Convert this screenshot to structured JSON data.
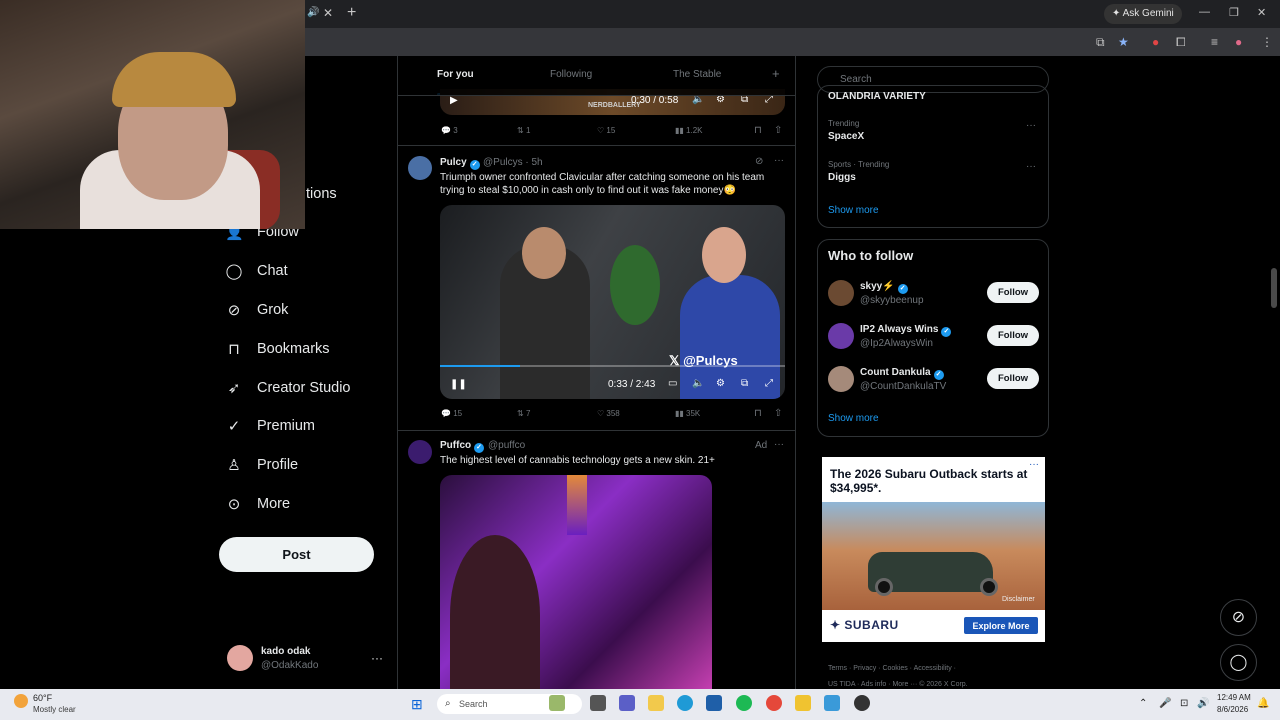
{
  "browser": {
    "ask_gemini": "Ask Gemini",
    "new_tab": "+",
    "tab_close": "✕",
    "minimize": "—",
    "restore": "❐",
    "close": "✕"
  },
  "webcam": {
    "partial_text": "tions"
  },
  "nav": {
    "items": [
      {
        "label": "Follow",
        "icon": "follow-icon"
      },
      {
        "label": "Chat",
        "icon": "chat-icon"
      },
      {
        "label": "Grok",
        "icon": "grok-icon"
      },
      {
        "label": "Bookmarks",
        "icon": "bookmark-icon"
      },
      {
        "label": "Creator Studio",
        "icon": "rocket-icon"
      },
      {
        "label": "Premium",
        "icon": "premium-icon"
      },
      {
        "label": "Profile",
        "icon": "profile-icon"
      },
      {
        "label": "More",
        "icon": "more-icon"
      }
    ],
    "post_label": "Post",
    "account": {
      "name": "kado odak",
      "handle": "@OdakKado",
      "more": "···"
    }
  },
  "feed": {
    "tabs": [
      "For you",
      "Following",
      "The Stable"
    ],
    "add_tab": "+",
    "tweet1": {
      "video_time": "0:30 / 0:58",
      "watermark": "NERDBALLERY",
      "replies": "3",
      "reposts": "1",
      "likes": "15",
      "views": "1.2K"
    },
    "tweet2": {
      "name": "Pulcy",
      "handle": "@Pulcys · 5h",
      "text": "Triumph owner confronted Clavicular after catching someone on his team trying to steal $10,000 in cash only to find out it was fake money😳",
      "video_watermark": "@Pulcys",
      "video_time": "0:33 / 2:43",
      "replies": "15",
      "reposts": "7",
      "likes": "358",
      "views": "35K"
    },
    "tweet3": {
      "name": "Puffco",
      "handle": "@puffco",
      "ad_label": "Ad",
      "text": "The highest level of cannabis technology gets a new skin. 21+"
    }
  },
  "sidebar": {
    "search_placeholder": "Search",
    "trends": [
      {
        "meta": "",
        "name": "OLANDRIA VARIETY"
      },
      {
        "meta": "Trending",
        "name": "SpaceX"
      },
      {
        "meta": "Sports · Trending",
        "name": "Diggs"
      }
    ],
    "show_more": "Show more",
    "who_to_follow": {
      "title": "Who to follow",
      "accounts": [
        {
          "name": "skyy⚡",
          "handle": "@skyybeenup"
        },
        {
          "name": "IP2 Always Wins",
          "handle": "@Ip2AlwaysWin"
        },
        {
          "name": "Count Dankula",
          "handle": "@CountDankulaTV"
        }
      ],
      "follow_label": "Follow",
      "show_more": "Show more"
    },
    "ad": {
      "headline": "The 2026 Subaru Outback starts at $34,995*.",
      "disclaimer": "Disclaimer",
      "brand": "SUBARU",
      "cta": "Explore More"
    },
    "footer_line1": "Terms · Privacy · Cookies · Accessibility ·",
    "footer_line2": "US TIDA · Ads info · More ··· © 2026 X Corp."
  },
  "taskbar": {
    "temp": "60°F",
    "weather": "Mostly clear",
    "search": "Search",
    "time": "12:49 AM",
    "date": "8/6/2026"
  }
}
